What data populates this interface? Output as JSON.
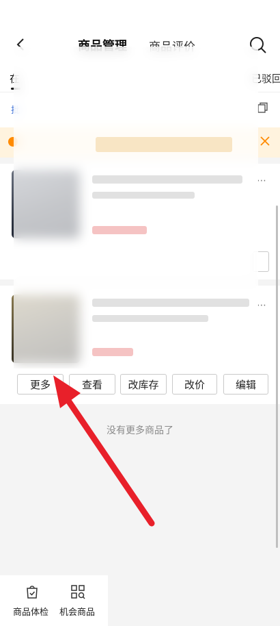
{
  "header": {
    "tab_main": "商品管理",
    "tab_reviews": "商品评价",
    "back_icon": "chevron-left-icon",
    "search_icon": "search-icon"
  },
  "filter_tabs": {
    "left_label": "在",
    "right_label": "已驳回"
  },
  "tool_row": {
    "link_label": "批"
  },
  "products": [
    {
      "buttons": [
        "更多",
        "查看",
        "改库存",
        "改价",
        "编辑"
      ]
    }
  ],
  "list_end": "没有更多商品了",
  "bottom_nav": [
    {
      "label": "商品体检",
      "icon": "bag-check-icon"
    },
    {
      "label": "机会商品",
      "icon": "grid-search-icon"
    }
  ],
  "colors": {
    "accent_orange": "#ff8a00",
    "notice_bg": "#fff3de",
    "arrow_red": "#e8202a",
    "link_blue": "#3b6fd6"
  }
}
